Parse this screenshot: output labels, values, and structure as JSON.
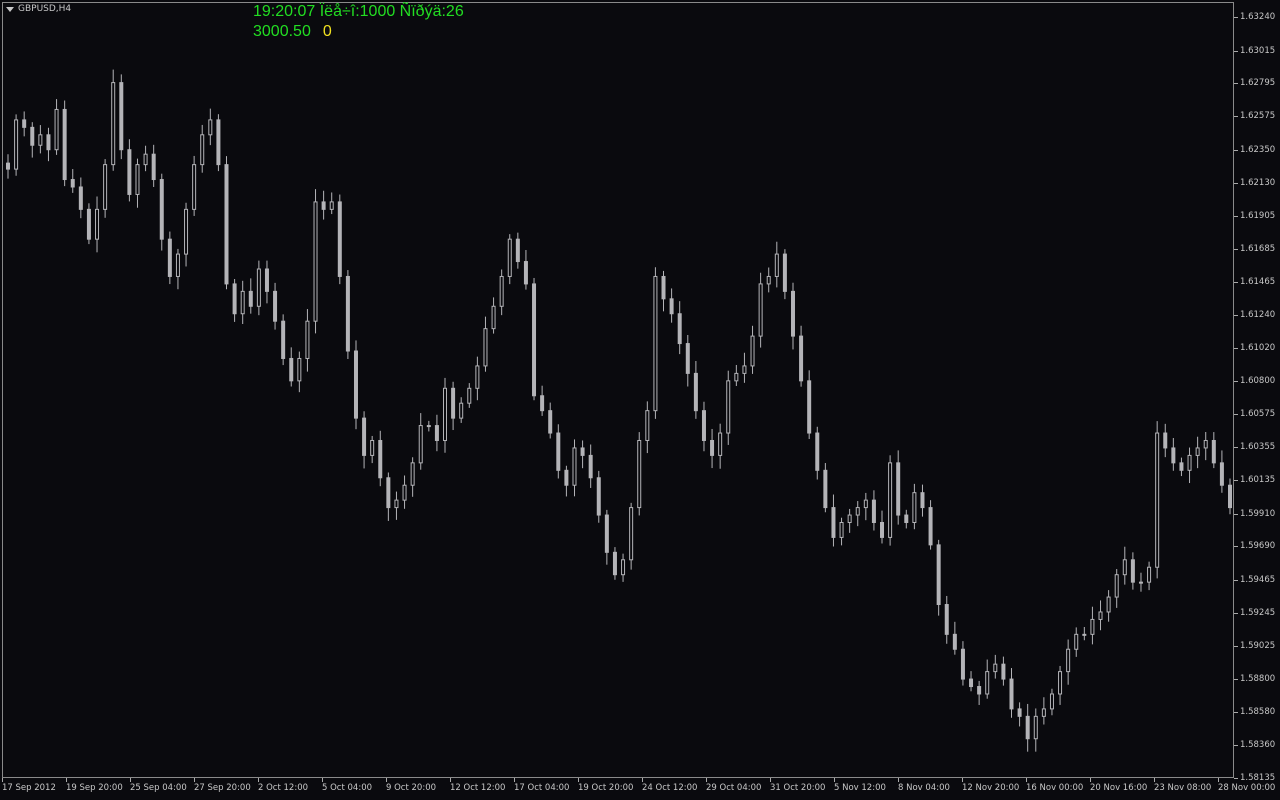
{
  "chart": {
    "symbol": "GBPUSD,H4",
    "info": {
      "line1": "19:20:07 Ïëå÷î:1000 Ñïðýä:26",
      "balance": "3000.50",
      "count": "0"
    },
    "colors": {
      "background": "#0a0a0e",
      "candle": "#b4b4b8",
      "axis": "#c8c8c8",
      "info_green": "#22dd22",
      "info_yellow": "#f0e020"
    }
  },
  "chart_data": {
    "type": "candlestick",
    "price_range": [
      1.5815,
      1.6324
    ],
    "price_ticks": [
      "1.63240",
      "1.63015",
      "1.62795",
      "1.62575",
      "1.62350",
      "1.62130",
      "1.61905",
      "1.61685",
      "1.61465",
      "1.61240",
      "1.61020",
      "1.60800",
      "1.60575",
      "1.60355",
      "1.60135",
      "1.59910",
      "1.59690",
      "1.59465",
      "1.59245",
      "1.59025",
      "1.58800",
      "1.58580",
      "1.58360",
      "1.58135"
    ],
    "time_ticks": [
      "17 Sep 2012",
      "19 Sep 20:00",
      "25 Sep 04:00",
      "27 Sep 20:00",
      "2 Oct 12:00",
      "5 Oct 04:00",
      "9 Oct 20:00",
      "12 Oct 12:00",
      "17 Oct 04:00",
      "19 Oct 20:00",
      "24 Oct 12:00",
      "29 Oct 04:00",
      "31 Oct 20:00",
      "5 Nov 12:00",
      "8 Nov 04:00",
      "12 Nov 20:00",
      "16 Nov 00:00",
      "20 Nov 16:00",
      "23 Nov 08:00",
      "28 Nov 00:00"
    ],
    "closes": [
      1.6222,
      1.6255,
      1.625,
      1.6238,
      1.6245,
      1.6235,
      1.6262,
      1.6215,
      1.621,
      1.6195,
      1.6175,
      1.6195,
      1.6225,
      1.628,
      1.6235,
      1.6205,
      1.6225,
      1.6232,
      1.6215,
      1.6175,
      1.615,
      1.6165,
      1.6195,
      1.6225,
      1.6245,
      1.6255,
      1.6225,
      1.6145,
      1.6125,
      1.614,
      1.613,
      1.6155,
      1.614,
      1.612,
      1.6095,
      1.608,
      1.6095,
      1.612,
      1.62,
      1.6195,
      1.62,
      1.615,
      1.61,
      1.6055,
      1.603,
      1.604,
      1.6015,
      1.5995,
      1.6,
      1.601,
      1.6025,
      1.605,
      1.605,
      1.604,
      1.6075,
      1.6055,
      1.6065,
      1.6075,
      1.609,
      1.6115,
      1.613,
      1.615,
      1.6175,
      1.616,
      1.6145,
      1.607,
      1.606,
      1.6045,
      1.602,
      1.601,
      1.6035,
      1.603,
      1.6015,
      1.599,
      1.5965,
      1.595,
      1.596,
      1.5995,
      1.604,
      1.606,
      1.615,
      1.6135,
      1.6125,
      1.6105,
      1.6085,
      1.606,
      1.604,
      1.603,
      1.6045,
      1.608,
      1.6085,
      1.609,
      1.611,
      1.6145,
      1.615,
      1.6165,
      1.614,
      1.611,
      1.608,
      1.6045,
      1.602,
      1.5995,
      1.5975,
      1.5985,
      1.599,
      1.5995,
      1.6,
      1.5985,
      1.5975,
      1.6025,
      1.599,
      1.5985,
      1.6005,
      1.5995,
      1.597,
      1.593,
      1.591,
      1.59,
      1.588,
      1.5875,
      1.587,
      1.5885,
      1.589,
      1.588,
      1.586,
      1.5855,
      1.584,
      1.5855,
      1.586,
      1.587,
      1.5885,
      1.59,
      1.591,
      1.591,
      1.592,
      1.5925,
      1.5935,
      1.595,
      1.596,
      1.5945,
      1.5945,
      1.5955,
      1.6045,
      1.6035,
      1.6025,
      1.602,
      1.603,
      1.6035,
      1.604,
      1.6025,
      1.601,
      1.5995
    ]
  }
}
